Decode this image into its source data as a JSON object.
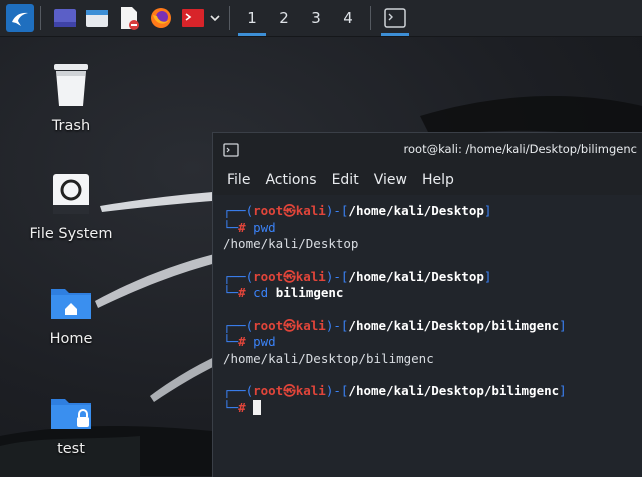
{
  "taskbar": {
    "workspaces": [
      "1",
      "2",
      "3",
      "4"
    ],
    "active_workspace": "1",
    "icons": [
      "kali-menu-icon",
      "desktop-icon",
      "file-manager-icon",
      "text-editor-icon",
      "firefox-icon",
      "terminal-icon",
      "chevron-down-icon",
      "terminal-window-icon"
    ]
  },
  "desktop": {
    "icons": [
      {
        "label": "Trash"
      },
      {
        "label": "File System"
      },
      {
        "label": "Home"
      },
      {
        "label": "test"
      }
    ]
  },
  "terminal": {
    "title": "root@kali: /home/kali/Desktop/bilimgenc",
    "menu": [
      "File",
      "Actions",
      "Edit",
      "View",
      "Help"
    ],
    "prompt_user": "root",
    "prompt_host": "kali",
    "prompt_hash": "#",
    "blocks": [
      {
        "path": "/home/kali/Desktop",
        "cmd": "pwd",
        "arg": "",
        "output": "/home/kali/Desktop"
      },
      {
        "path": "/home/kali/Desktop",
        "cmd": "cd",
        "arg": "bilimgenc",
        "output": ""
      },
      {
        "path": "/home/kali/Desktop/bilimgenc",
        "cmd": "pwd",
        "arg": "",
        "output": "/home/kali/Desktop/bilimgenc"
      },
      {
        "path": "/home/kali/Desktop/bilimgenc",
        "cmd": "",
        "arg": "",
        "output": ""
      }
    ]
  },
  "colors": {
    "accent": "#3d8fd6",
    "prompt_blue": "#3b82f6",
    "prompt_red": "#e0453a"
  }
}
